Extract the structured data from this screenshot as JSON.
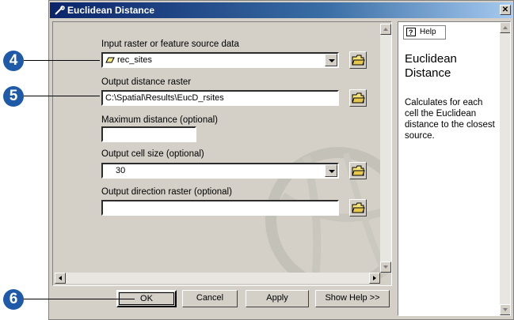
{
  "window": {
    "title": "Euclidean Distance",
    "close_glyph": "✕"
  },
  "form": {
    "input": {
      "label": "Input raster or feature source data",
      "value": "rec_sites"
    },
    "output_distance": {
      "label": "Output distance raster",
      "value": "C:\\Spatial\\Results\\EucD_rsites"
    },
    "max_distance": {
      "label": "Maximum distance (optional)",
      "value": ""
    },
    "cell_size": {
      "label": "Output cell size (optional)",
      "value": "30"
    },
    "output_direction": {
      "label": "Output direction raster (optional)",
      "value": ""
    }
  },
  "buttons": {
    "ok": "OK",
    "cancel": "Cancel",
    "apply": "Apply",
    "show_help": "Show Help >>"
  },
  "help": {
    "tab_label": "Help",
    "title": "Euclidean Distance",
    "body": "Calculates for each cell the Euclidean distance to the closest source."
  },
  "callouts": [
    "4",
    "5",
    "6"
  ],
  "colors": {
    "callout": "#1f5aa8",
    "titlebar": "#0a246a",
    "dialog": "#d4d0c8"
  },
  "icons": [
    "wrench-icon",
    "close-icon",
    "polygon-layer-icon",
    "open-folder-icon",
    "help-icon"
  ]
}
